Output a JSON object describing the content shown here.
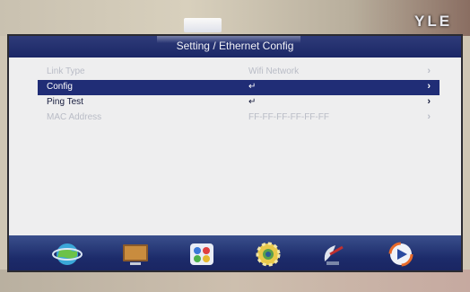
{
  "brand": "YLE",
  "header": {
    "title": "Setting / Ethernet Config"
  },
  "menu": {
    "items": [
      {
        "label": "Link Type",
        "value": "Wifi Network",
        "arrow": "›",
        "state": "dim"
      },
      {
        "label": "Config",
        "value": "↵",
        "arrow": "›",
        "state": "selected"
      },
      {
        "label": "Ping Test",
        "value": "↵",
        "arrow": "›",
        "state": "normal"
      },
      {
        "label": "MAC Address",
        "value": "FF-FF-FF-FF-FF-FF",
        "arrow": "›",
        "state": "dim"
      }
    ]
  },
  "dock": {
    "icons": [
      "globe-network-icon",
      "tv-monitor-icon",
      "apps-icon",
      "settings-gear-icon",
      "satellite-dish-icon",
      "media-play-icon"
    ]
  },
  "colors": {
    "title_bar": "#1f2a6b",
    "selected_row": "#202d76",
    "screen_bg": "#eeeeef",
    "dock": "#22316f"
  }
}
